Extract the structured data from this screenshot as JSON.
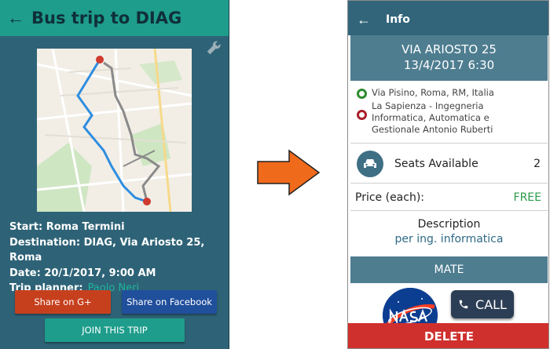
{
  "left": {
    "appbar": {
      "title": "Bus trip to DIAG"
    },
    "map": {
      "icon": "map-with-bus-route"
    },
    "trip": {
      "start_line": "Start: Roma Termini",
      "destination_line": "Destination: DIAG, Via Ariosto 25, Roma",
      "date_line": "Date: 20/1/2017, 9:00 AM",
      "planner_label": "Trip planner:",
      "planner_name": "Paolo Neri"
    },
    "buttons": {
      "gplus": "Share on G+",
      "facebook": "Share on Facebook",
      "join": "JOIN THIS TRIP"
    },
    "colors": {
      "appbar": "#1e9d8c",
      "background": "#2e6377",
      "gplus": "#c7401e",
      "facebook": "#204f9c",
      "planner_name": "#1fb49d"
    }
  },
  "arrow": {
    "icon": "right-arrow",
    "color": "#f06a1c"
  },
  "right": {
    "appbar": {
      "title": "Info"
    },
    "header": {
      "address": "VIA ARIOSTO 25",
      "datetime": "13/4/2017 6:30"
    },
    "route": {
      "origin": "Via Pisino, Roma, RM, Italia",
      "destination": "La Sapienza - Ingegneria Informatica, Automatica e Gestionale Antonio Ruberti"
    },
    "seats": {
      "label": "Seats Available",
      "count": "2"
    },
    "price": {
      "label": "Price (each):",
      "value": "FREE"
    },
    "description": {
      "label": "Description",
      "value": "per ing. informatica"
    },
    "mate": {
      "label": "MATE"
    },
    "call": {
      "label": "CALL"
    },
    "delete": {
      "label": "DELETE"
    },
    "colors": {
      "appbar": "#32657a",
      "section": "#4e7d90",
      "free": "#2a9a48",
      "delete": "#d0302d"
    }
  }
}
